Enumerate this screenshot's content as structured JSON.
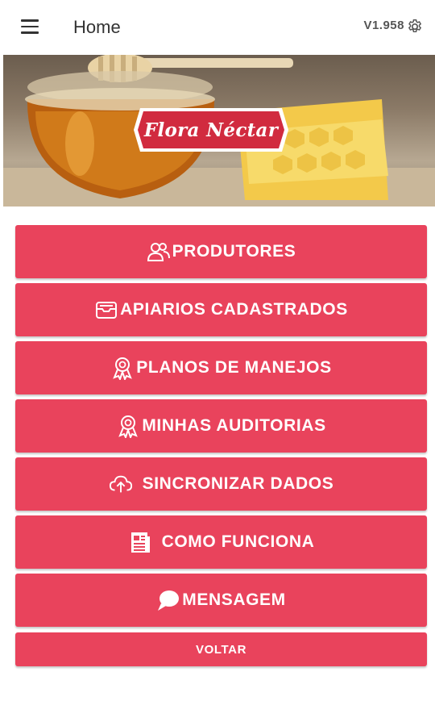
{
  "header": {
    "title": "Home",
    "version": "V1.958"
  },
  "banner": {
    "logo_text": "Flora Néctar"
  },
  "menu": {
    "items": [
      {
        "label": "PRODUTORES",
        "icon": "people-icon"
      },
      {
        "label": "APIARIOS CADASTRADOS",
        "icon": "archive-box-icon"
      },
      {
        "label": "PLANOS DE MANEJOS",
        "icon": "award-ribbon-icon"
      },
      {
        "label": "MINHAS AUDITORIAS",
        "icon": "award-ribbon-icon"
      },
      {
        "label": "SINCRONIZAR DADOS",
        "icon": "cloud-upload-icon"
      },
      {
        "label": "COMO FUNCIONA",
        "icon": "document-icon"
      },
      {
        "label": "MENSAGEM",
        "icon": "chat-bubble-icon"
      }
    ],
    "back_label": "VOLTAR"
  },
  "colors": {
    "button": "#e9435c",
    "logo_red": "#d12b3f"
  }
}
